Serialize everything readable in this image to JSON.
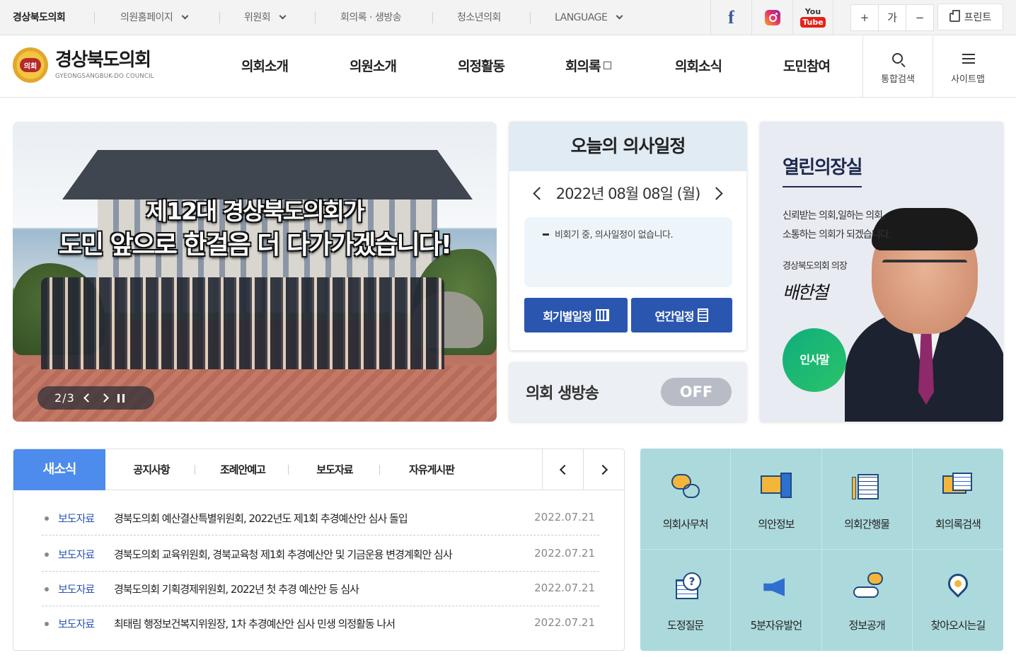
{
  "topbar": {
    "brand": "경상북도의회",
    "links": [
      {
        "label": "의원홈페이지",
        "dropdown": true
      },
      {
        "label": "위원회",
        "dropdown": true
      },
      {
        "label": "회의록 · 생방송",
        "dropdown": false
      },
      {
        "label": "청소년의회",
        "dropdown": false
      },
      {
        "label": "LANGUAGE",
        "dropdown": true
      }
    ],
    "sns": {
      "facebook": "f",
      "youtube_top": "You",
      "youtube_bottom": "Tube"
    },
    "font_controls": [
      "+",
      "가",
      "−"
    ],
    "print_label": "프린트"
  },
  "header": {
    "logo_emblem": "의회",
    "logo_title": "경상북도의회",
    "logo_subtitle": "GYEONGSANGBUK-DO COUNCIL",
    "nav": [
      "의회소개",
      "의원소개",
      "의정활동",
      "회의록",
      "의회소식",
      "도민참여"
    ],
    "search_label": "통합검색",
    "sitemap_label": "사이트맵"
  },
  "hero": {
    "caption_line1": "제12대 경상북도의회가",
    "caption_line2": "도민 앞으로 한걸음 더 다가가겠습니다!",
    "counter": "2/3"
  },
  "schedule": {
    "title": "오늘의 의사일정",
    "date": "2022년 08월 08일 (월)",
    "message": "비회기 중, 의사일정이 없습니다.",
    "btn_session": "회기별일정",
    "btn_annual": "연간일정"
  },
  "live": {
    "label": "의회 생방송",
    "status": "OFF"
  },
  "speaker": {
    "title": "열린의장실",
    "desc_line1": "신뢰받는 의회,일하는 의회,",
    "desc_line2": "소통하는 의회가 되겠습니다.",
    "name": "경상북도의회 의장",
    "signature": "배한철",
    "button": "인사말"
  },
  "news": {
    "tabs": [
      "새소식",
      "공지사항",
      "조례안예고",
      "보도자료",
      "자유게시판"
    ],
    "rows": [
      {
        "category": "보도자료",
        "title": "경북도의회 예산결산특별위원회, 2022년도 제1회 추경예산안 심사 돌입",
        "date": "2022.07.21"
      },
      {
        "category": "보도자료",
        "title": "경북도의회 교육위원회, 경북교육청 제1회 추경예산안 및 기금운용 변경계획안 심사",
        "date": "2022.07.21"
      },
      {
        "category": "보도자료",
        "title": "경북도의회 기획경제위원회, 2022년 첫 추경 예산안 등 심사",
        "date": "2022.07.21"
      },
      {
        "category": "보도자료",
        "title": "최태림 행정보건복지위원장, 1차 추경예산안 심사 민생 의정활동 나서",
        "date": "2022.07.21"
      }
    ]
  },
  "quick_menu": [
    {
      "label": "의회사무처",
      "icon": "chat-phone-icon"
    },
    {
      "label": "의안정보",
      "icon": "monitor-books-icon"
    },
    {
      "label": "의회간행물",
      "icon": "publication-icon"
    },
    {
      "label": "회의록검색",
      "icon": "minutes-search-icon"
    },
    {
      "label": "도정질문",
      "icon": "question-doc-icon"
    },
    {
      "label": "5분자유발언",
      "icon": "megaphone-icon"
    },
    {
      "label": "정보공개",
      "icon": "hand-info-icon"
    },
    {
      "label": "찾아오시는길",
      "icon": "location-pin-icon"
    }
  ],
  "colors": {
    "primary_blue": "#2a56b0",
    "tab_active": "#4d8bed",
    "quick_bg": "#acd9dc",
    "green_button": "#0fae7c"
  }
}
